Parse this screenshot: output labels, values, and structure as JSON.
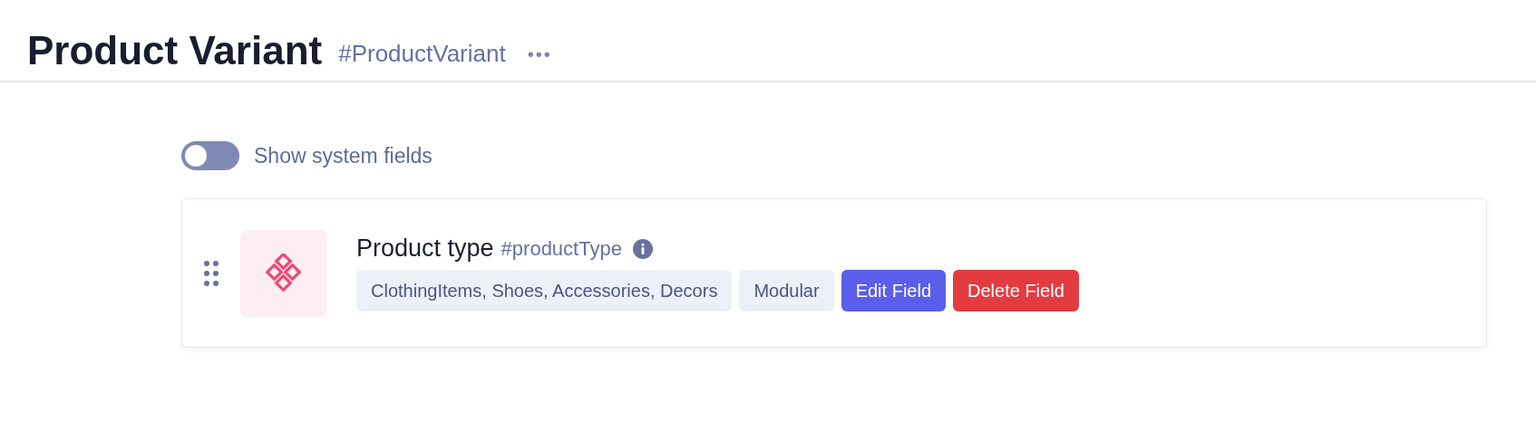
{
  "header": {
    "title": "Product Variant",
    "api_id": "#ProductVariant",
    "more": "•••"
  },
  "system_fields_toggle": {
    "label": "Show system fields",
    "on": false
  },
  "fields": [
    {
      "name": "Product type",
      "api_id": "#productType",
      "chips": [
        {
          "kind": "tag",
          "label": "ClothingItems, Shoes, Accessories, Decors"
        },
        {
          "kind": "tag",
          "label": "Modular"
        },
        {
          "kind": "primary",
          "label": "Edit Field"
        },
        {
          "kind": "danger",
          "label": "Delete Field"
        }
      ]
    }
  ]
}
